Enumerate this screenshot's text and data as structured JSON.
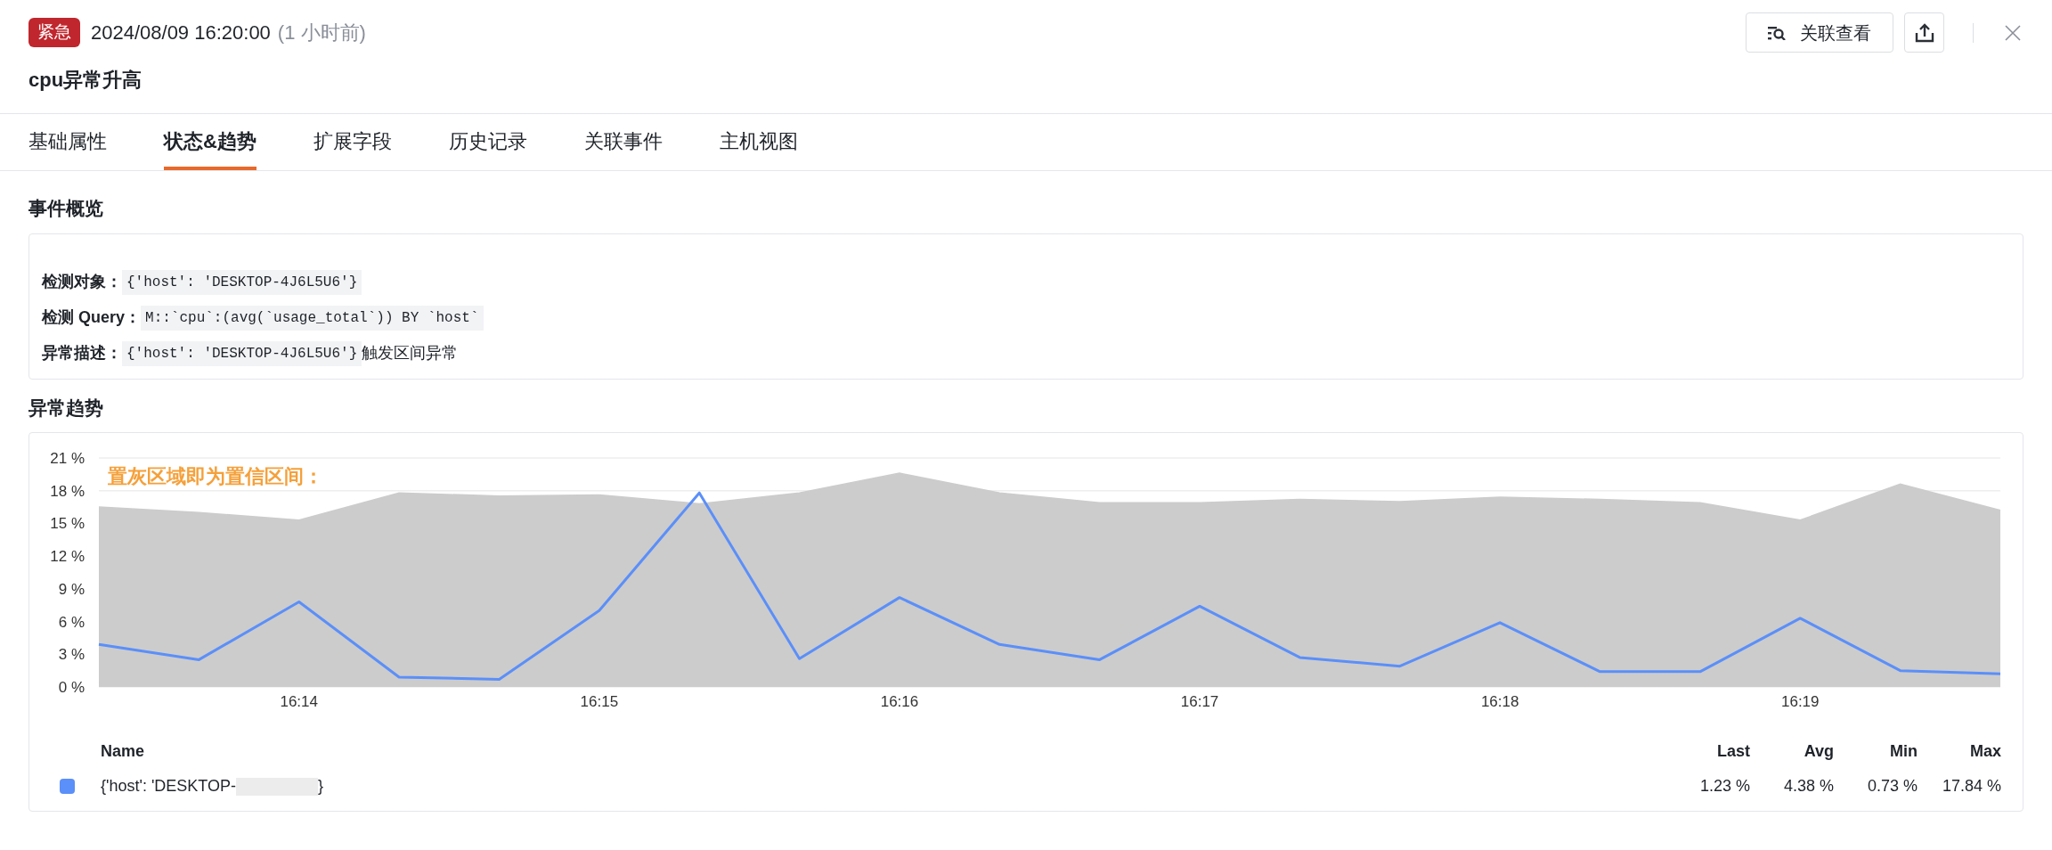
{
  "header": {
    "severity": "紧急",
    "time": "2024/08/09 16:20:00",
    "relative_time": "(1 小时前)",
    "title": "cpu异常升高",
    "related_button": "关联查看"
  },
  "tabs": [
    {
      "label": "基础属性",
      "selected": false
    },
    {
      "label": "状态&趋势",
      "selected": true
    },
    {
      "label": "扩展字段",
      "selected": false
    },
    {
      "label": "历史记录",
      "selected": false
    },
    {
      "label": "关联事件",
      "selected": false
    },
    {
      "label": "主机视图",
      "selected": false
    }
  ],
  "overview": {
    "title": "事件概览",
    "fields": [
      {
        "label": "检测对象：",
        "value": "{'host': 'DESKTOP-4J6L5U6'}"
      },
      {
        "label": "检测 Query：",
        "value": "M::`cpu`:(avg(`usage_total`)) BY `host`"
      },
      {
        "label": "异常描述：",
        "value": "{'host': 'DESKTOP-4J6L5U6'}",
        "suffix": "触发区间异常"
      }
    ]
  },
  "trend": {
    "title": "异常趋势",
    "chart_data": {
      "type": "line",
      "categories": [
        null,
        null,
        "16:14",
        null,
        null,
        "16:15",
        null,
        null,
        "16:16",
        null,
        null,
        "16:17",
        null,
        null,
        "16:18",
        null,
        null,
        "16:19",
        null,
        null
      ],
      "series": [
        {
          "color": "#cccccc",
          "values": [
            16.5,
            16.0,
            15.3,
            17.8,
            17.5,
            17.6,
            16.8,
            17.8,
            19.6,
            17.8,
            16.9,
            16.9,
            17.2,
            17.0,
            17.4,
            17.2,
            16.9,
            15.3,
            18.6,
            16.2
          ]
        },
        {
          "color": "#5b8ff9",
          "values": [
            3.9,
            2.5,
            7.8,
            0.9,
            0.7,
            7.0,
            17.8,
            2.6,
            8.2,
            3.9,
            2.5,
            7.4,
            2.7,
            1.9,
            5.9,
            1.4,
            1.4,
            6.3,
            1.5,
            1.2
          ]
        }
      ],
      "ylim": [
        0,
        21
      ],
      "yticks": [
        {
          "value": 0,
          "label": "0 %"
        },
        {
          "value": 3,
          "label": "3 %"
        },
        {
          "value": 6,
          "label": "6 %"
        },
        {
          "value": 9,
          "label": "9 %"
        },
        {
          "value": 12,
          "label": "12 %"
        },
        {
          "value": 15,
          "label": "15 %"
        },
        {
          "value": 18,
          "label": "18 %"
        },
        {
          "value": 21,
          "label": "21 %"
        }
      ],
      "annotations": [
        {
          "text": "置灰区域即为置信区间："
        }
      ]
    },
    "series_filled": [
      true,
      false
    ],
    "legend": {
      "columns": [
        "Name",
        "Last",
        "Avg",
        "Min",
        "Max"
      ],
      "rows": [
        {
          "name_start": "{'host': 'DESKTOP-",
          "name_end": "}",
          "color": "#5b8ff9",
          "last": "1.23 %",
          "avg": "4.38 %",
          "min": "0.73 %",
          "max": "17.84 %"
        }
      ]
    }
  }
}
